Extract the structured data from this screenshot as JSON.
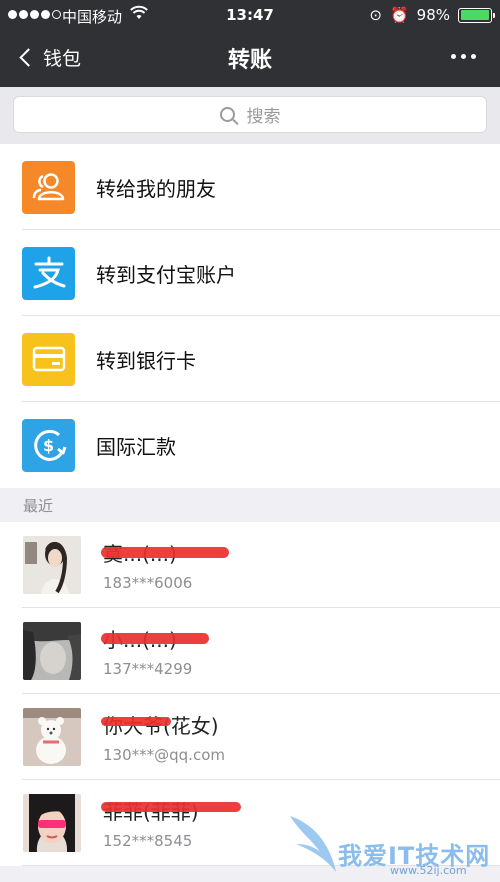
{
  "status": {
    "carrier": "中国移动",
    "time": "13:47",
    "battery": "98%",
    "battery_level": 0.98
  },
  "nav": {
    "back_label": "钱包",
    "title": "转账"
  },
  "search": {
    "placeholder": "搜索"
  },
  "menu": [
    {
      "label": "转给我的朋友",
      "icon": "friends-icon",
      "color": "#f5892a"
    },
    {
      "label": "转到支付宝账户",
      "icon": "alipay-icon",
      "color": "#1ea2e8"
    },
    {
      "label": "转到银行卡",
      "icon": "bank-card-icon",
      "color": "#f8c21c"
    },
    {
      "label": "国际汇款",
      "icon": "international-remit-icon",
      "color": "#2ea3e6"
    }
  ],
  "section": {
    "recent_label": "最近"
  },
  "recent": [
    {
      "name": "寞...(...)",
      "phone": "183***6006"
    },
    {
      "name": "小...(...)",
      "phone": "137***4299"
    },
    {
      "name": "你大爷(花女)",
      "phone": "130***@qq.com"
    },
    {
      "name": "菲菲(菲菲)",
      "phone": "152***8545"
    }
  ],
  "watermark": {
    "text": "我爱IT技术网",
    "url": "www.52ij.com"
  }
}
